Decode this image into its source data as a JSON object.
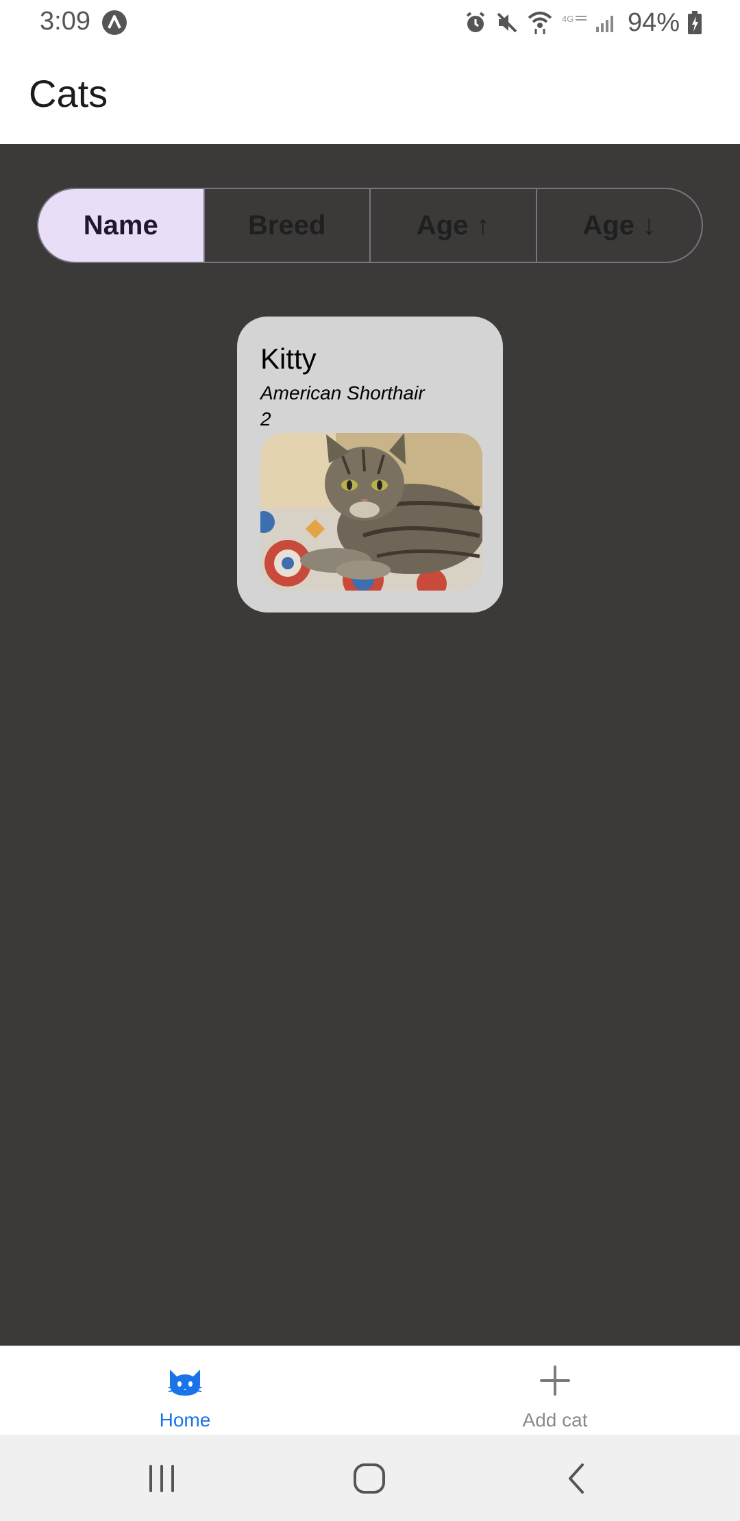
{
  "status_bar": {
    "time": "3:09",
    "battery": "94%"
  },
  "app_bar": {
    "title": "Cats"
  },
  "sort_options": [
    {
      "label": "Name",
      "selected": true
    },
    {
      "label": "Breed",
      "selected": false
    },
    {
      "label": "Age ↑",
      "selected": false
    },
    {
      "label": "Age ↓",
      "selected": false
    }
  ],
  "cats": [
    {
      "name": "Kitty",
      "breed": "American Shorthair",
      "age": "2"
    }
  ],
  "bottom_nav": {
    "home_label": "Home",
    "add_label": "Add cat",
    "active": "home"
  },
  "colors": {
    "content_bg": "#3b3a39",
    "selected_segment": "#e8def8",
    "card_bg": "#d4d4d4",
    "accent": "#1a73e8"
  },
  "icons": {
    "status": [
      "alarm-icon",
      "mute-icon",
      "wifi-icon",
      "lte-icon",
      "signal-icon",
      "battery-charging-icon"
    ],
    "nav": [
      "cat-icon",
      "plus-icon"
    ],
    "system": [
      "recent-apps-icon",
      "home-circle-icon",
      "back-icon"
    ]
  }
}
